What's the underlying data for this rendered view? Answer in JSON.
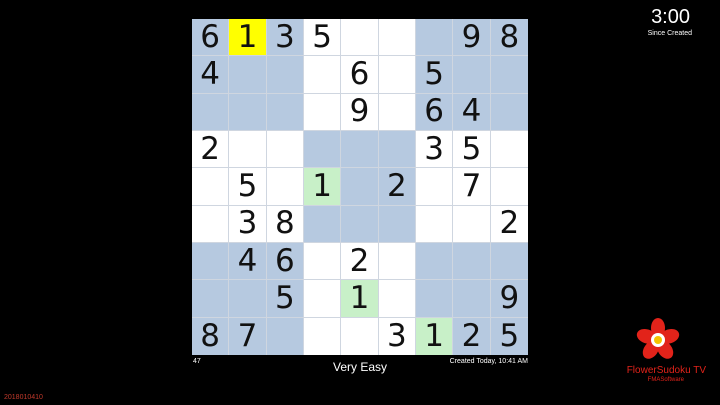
{
  "game": {
    "puzzle_number": "47",
    "difficulty": "Very Easy",
    "created": "Created Today, 10:41 AM",
    "timer": "3:00",
    "timer_label": "Since Created",
    "version": "2018010410",
    "brand": "FlowerSudoku TV",
    "vendor": "FMASoftware",
    "selected_cell": [
      0,
      1
    ],
    "highlight_cells": [
      [
        4,
        3
      ],
      [
        7,
        4
      ],
      [
        8,
        6
      ]
    ],
    "colors": {
      "shade": "#b6c9e0",
      "selected": "#ffff00",
      "highlight": "#c8f0c8"
    },
    "grid": [
      [
        "6",
        "1",
        "3",
        "5",
        "",
        "",
        "",
        "9",
        "8"
      ],
      [
        "4",
        "",
        "",
        "",
        "6",
        "",
        "5",
        "",
        ""
      ],
      [
        "",
        "",
        "",
        "",
        "9",
        "",
        "6",
        "4",
        ""
      ],
      [
        "2",
        "",
        "",
        "",
        "",
        "",
        "3",
        "5",
        ""
      ],
      [
        "",
        "5",
        "",
        "1",
        "",
        "2",
        "",
        "7",
        ""
      ],
      [
        "",
        "3",
        "8",
        "",
        "",
        "",
        "",
        "",
        "2"
      ],
      [
        "",
        "4",
        "6",
        "",
        "2",
        "",
        "",
        "",
        ""
      ],
      [
        "",
        "",
        "5",
        "",
        "1",
        "",
        "",
        "",
        "9"
      ],
      [
        "8",
        "7",
        "",
        "",
        "",
        "3",
        "1",
        "2",
        "5"
      ]
    ]
  }
}
